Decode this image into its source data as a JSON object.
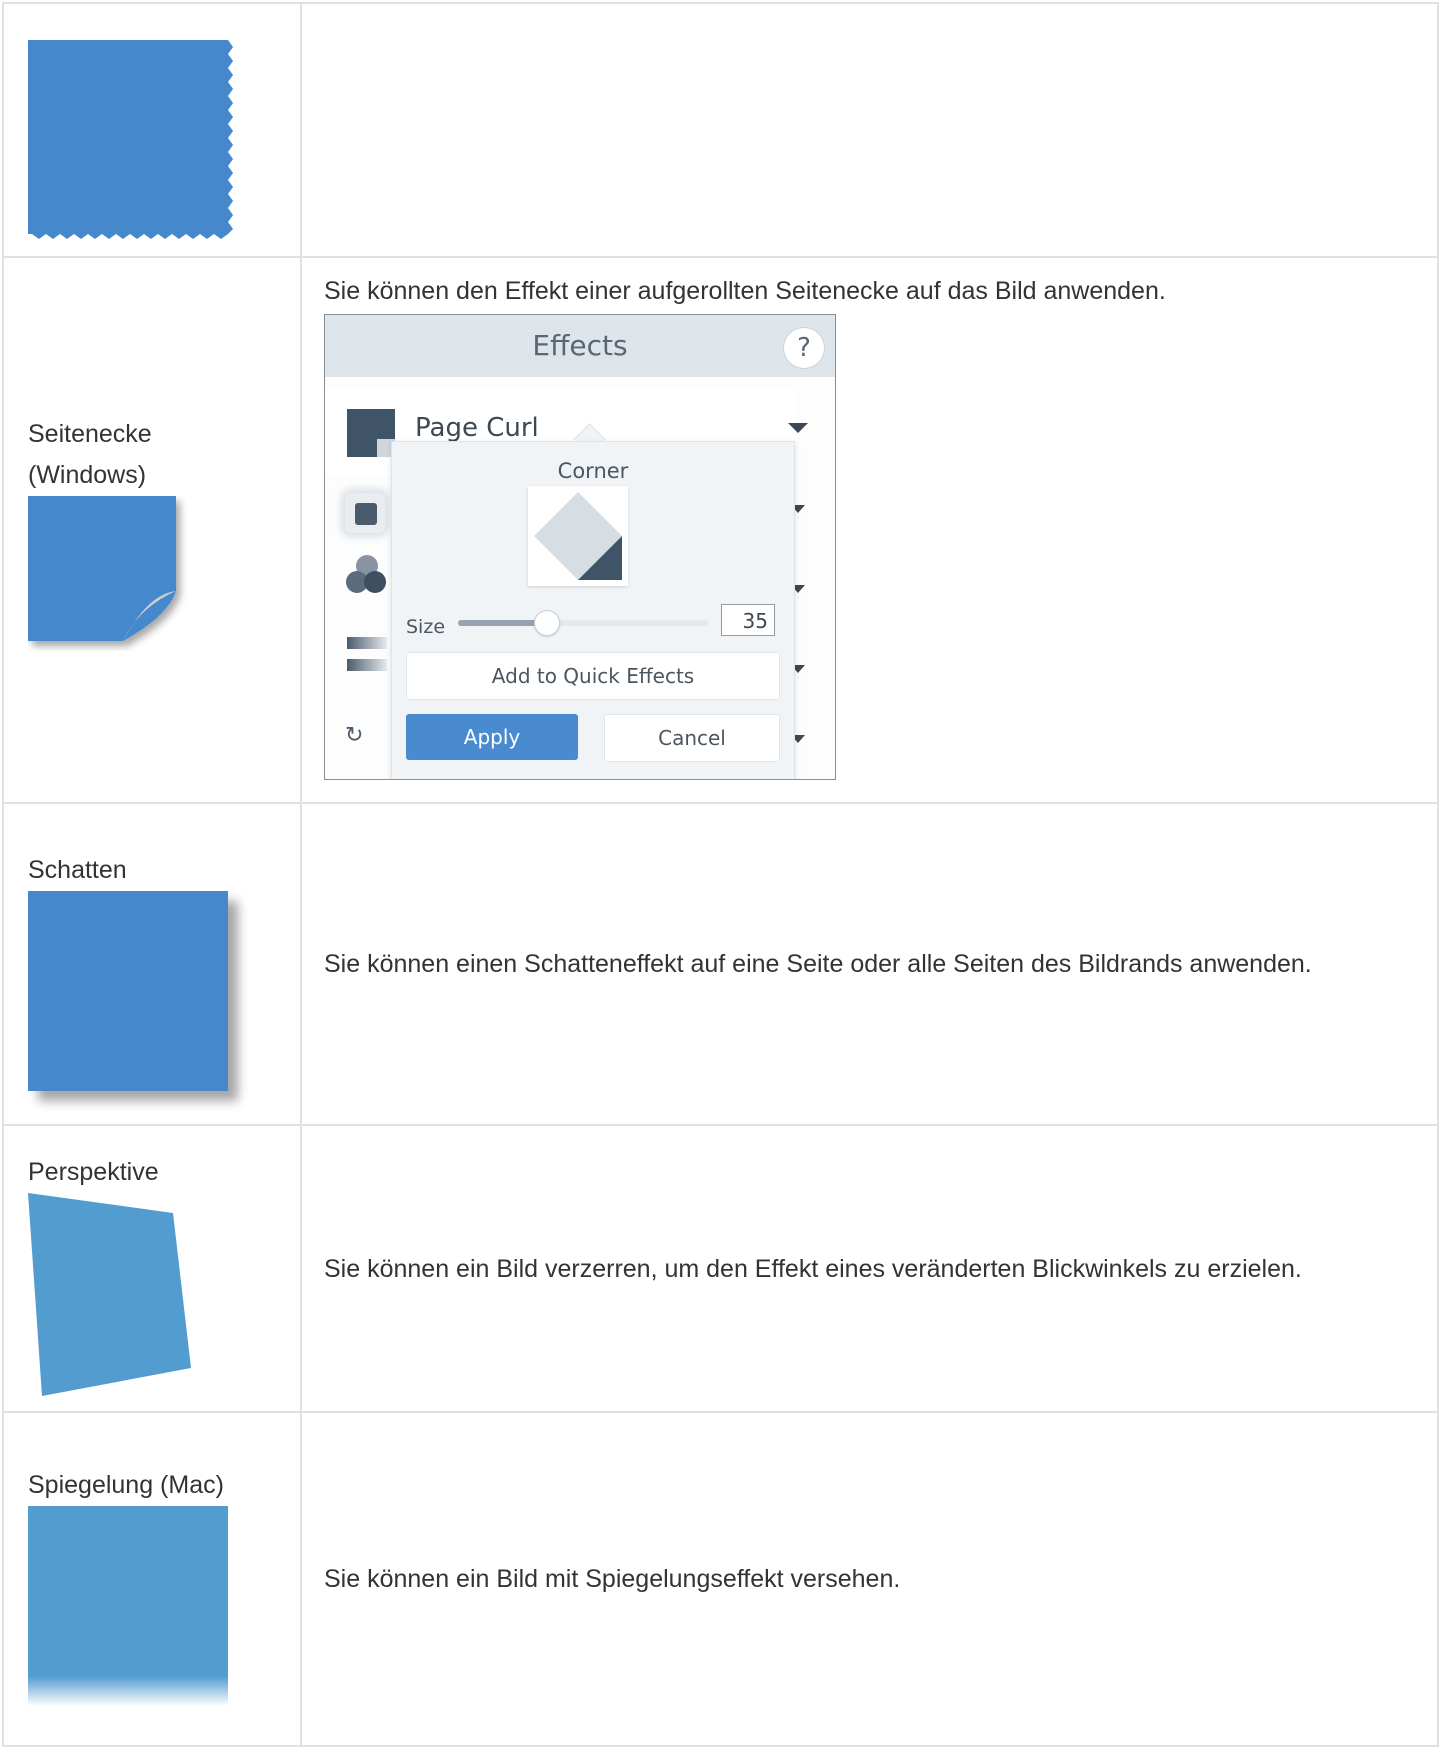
{
  "rows": [
    {
      "label": "",
      "description": ""
    },
    {
      "label": "Seitenecke (Windows)",
      "description": "Sie können den Effekt einer aufgerollten Seitenecke auf das Bild anwenden."
    },
    {
      "label": "Schatten",
      "description": "Sie können einen Schatteneffekt auf eine Seite oder alle Seiten des Bildrands anwenden."
    },
    {
      "label": "Perspektive",
      "description": "Sie können ein Bild verzerren, um den Effekt eines veränderten Blickwinkels zu erzielen."
    },
    {
      "label": "Spiegelung (Mac)",
      "description": "Sie können ein Bild mit Spiegelungseffekt versehen."
    }
  ],
  "dialog": {
    "title": "Effects",
    "help": "?",
    "selected_effect": "Page Curl",
    "popover": {
      "title": "Corner",
      "size_label": "Size",
      "size_value": "35",
      "size_fraction": 0.35,
      "quick_effects_label": "Add to Quick Effects",
      "apply_label": "Apply",
      "cancel_label": "Cancel"
    }
  },
  "colors": {
    "sample_blue": "#4588cc",
    "sample_light_blue": "#529ccf",
    "apply_blue": "#4a8bd0",
    "border": "#e1e1e1"
  }
}
